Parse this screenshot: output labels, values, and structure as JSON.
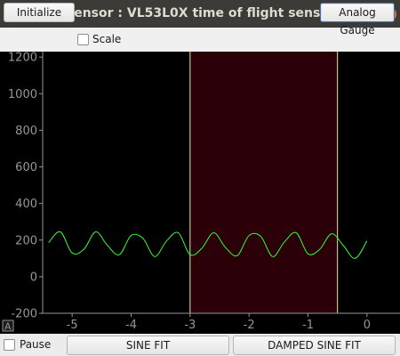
{
  "window": {
    "title": "Sensor : VL53L0X time of flight sensor",
    "close_glyph": "×"
  },
  "toolbar": {
    "initialize_label": "Initialize",
    "scale_label": "Scale",
    "scale_checked": false,
    "analog_gauge_label": "Analog Gauge"
  },
  "plot": {
    "auto_range_label": "A"
  },
  "bottom": {
    "pause_label": "Pause",
    "pause_checked": false,
    "sine_fit_label": "SINE FIT",
    "damped_sine_fit_label": "DAMPED SINE FIT"
  },
  "colors": {
    "plot_background": "#000000",
    "region_fill": "#2b0009",
    "region_line": "#e8e89a",
    "curve": "#33ff33",
    "axis": "#969696",
    "titlebar": "#3c3b37",
    "close_button": "#ed6a3c"
  },
  "chart_data": {
    "type": "line",
    "x_tick_labels": [
      "-5",
      "-4",
      "-3",
      "-2",
      "-1",
      "0"
    ],
    "y_tick_labels": [
      "1200",
      "1000",
      "800",
      "600",
      "400",
      "200",
      "0",
      "-200"
    ],
    "xlim": [
      -5.5,
      0.5
    ],
    "ylim": [
      -200,
      1230
    ],
    "grid": false,
    "region": [
      -3.0,
      -0.5
    ],
    "series": [
      {
        "x": [
          -5.4,
          -5.2,
          -5.0,
          -4.8,
          -4.6,
          -4.4,
          -4.2,
          -4.0,
          -3.8,
          -3.6,
          -3.4,
          -3.2,
          -3.0,
          -2.8,
          -2.6,
          -2.4,
          -2.2,
          -2.0,
          -1.8,
          -1.6,
          -1.4,
          -1.2,
          -1.0,
          -0.8,
          -0.6,
          -0.4,
          -0.2,
          0.0
        ],
        "values": [
          185,
          245,
          130,
          150,
          245,
          170,
          120,
          225,
          210,
          110,
          195,
          240,
          120,
          155,
          240,
          160,
          115,
          225,
          220,
          110,
          190,
          240,
          125,
          150,
          235,
          170,
          100,
          195
        ]
      }
    ]
  }
}
